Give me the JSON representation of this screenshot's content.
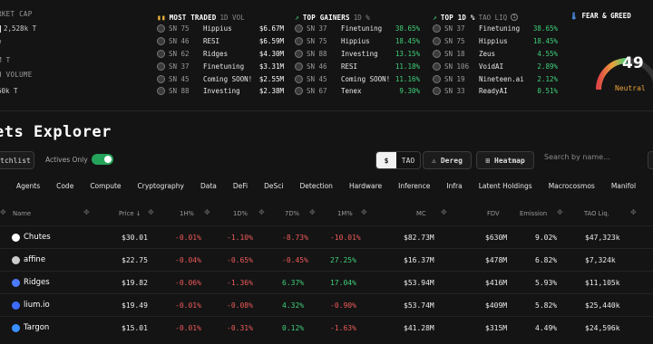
{
  "stats": {
    "market_cap_label": "RKET CAP",
    "market_cap_value": "2,528k T",
    "v_label": "V",
    "t_label": "M T",
    "volume_label": "H VOLUME",
    "volume_value": "60k T"
  },
  "most_traded": {
    "title": "MOST TRADED",
    "subtitle": "1D VOL",
    "rows": [
      {
        "sn": "SN 75",
        "name": "Hippius",
        "value": "$6.67M"
      },
      {
        "sn": "SN 46",
        "name": "RESI",
        "value": "$6.59M"
      },
      {
        "sn": "SN 62",
        "name": "Ridges",
        "value": "$4.30M"
      },
      {
        "sn": "SN 37",
        "name": "Finetuning",
        "value": "$3.31M"
      },
      {
        "sn": "SN 45",
        "name": "Coming SOON!",
        "value": "$2.55M"
      },
      {
        "sn": "SN 88",
        "name": "Investing",
        "value": "$2.38M"
      }
    ]
  },
  "top_gainers": {
    "title": "TOP GAINERS",
    "subtitle": "1D %",
    "rows": [
      {
        "sn": "SN 37",
        "name": "Finetuning",
        "value": "38.65%"
      },
      {
        "sn": "SN 75",
        "name": "Hippius",
        "value": "18.45%"
      },
      {
        "sn": "SN 88",
        "name": "Investing",
        "value": "13.15%"
      },
      {
        "sn": "SN 46",
        "name": "RESI",
        "value": "11.18%"
      },
      {
        "sn": "SN 45",
        "name": "Coming SOON!",
        "value": "11.16%"
      },
      {
        "sn": "SN 67",
        "name": "Tenex",
        "value": "9.30%"
      }
    ]
  },
  "top_1d": {
    "title": "TOP 1D %",
    "subtitle": "TAO LIQ",
    "rows": [
      {
        "sn": "SN 37",
        "name": "Finetuning",
        "value": "38.65%"
      },
      {
        "sn": "SN 75",
        "name": "Hippius",
        "value": "18.45%"
      },
      {
        "sn": "SN 18",
        "name": "Zeus",
        "value": "4.55%"
      },
      {
        "sn": "SN 106",
        "name": "VoidAI",
        "value": "2.89%"
      },
      {
        "sn": "SN 19",
        "name": "Nineteen.ai",
        "value": "2.12%"
      },
      {
        "sn": "SN 33",
        "name": "ReadyAI",
        "value": "0.51%"
      }
    ]
  },
  "fear_greed": {
    "title": "FEAR & GREED",
    "value": "49",
    "level": 0.49,
    "label": "Neutral"
  },
  "explorer": {
    "title": "ets Explorer",
    "watchlist": "tchlist",
    "actives_only": "Actives Only",
    "currency_usd": "$",
    "currency_tao": "TAO",
    "dereg": "Dereg",
    "heatmap": "Heatmap",
    "search_placeholder": "Search by name...",
    "categories": [
      "Agents",
      "Code",
      "Compute",
      "Cryptography",
      "Data",
      "DeFi",
      "DeSci",
      "Detection",
      "Hardware",
      "Inference",
      "Infra",
      "Latent Holdings",
      "Macrocosmos",
      "Manifol"
    ]
  },
  "table": {
    "headers": {
      "name": "Name",
      "price": "Price",
      "h1": "1H%",
      "d1": "1D%",
      "d7": "7D%",
      "m1": "1M%",
      "mc": "MC",
      "fdv": "FDV",
      "emission": "Emission",
      "tao_liq": "TAO Liq."
    },
    "rows": [
      {
        "name": "Chutes",
        "price": "$30.01",
        "h1": "-0.01%",
        "d1": "-1.10%",
        "d7": "-8.73%",
        "m1": "-10.01%",
        "mc": "$82.73M",
        "fdv": "$630M",
        "emission": "9.02%",
        "tao_liq": "$47,323k"
      },
      {
        "name": "affine",
        "price": "$22.75",
        "h1": "-0.04%",
        "d1": "-0.65%",
        "d7": "-0.45%",
        "m1": "27.25%",
        "mc": "$16.37M",
        "fdv": "$478M",
        "emission": "6.82%",
        "tao_liq": "$7,324k"
      },
      {
        "name": "Ridges",
        "price": "$19.82",
        "h1": "-0.06%",
        "d1": "-1.36%",
        "d7": "6.37%",
        "m1": "17.04%",
        "mc": "$53.94M",
        "fdv": "$416M",
        "emission": "5.93%",
        "tao_liq": "$11,105k"
      },
      {
        "name": "lium.io",
        "price": "$19.49",
        "h1": "-0.01%",
        "d1": "-0.08%",
        "d7": "4.32%",
        "m1": "-0.90%",
        "mc": "$53.74M",
        "fdv": "$409M",
        "emission": "5.82%",
        "tao_liq": "$25,440k"
      },
      {
        "name": "Targon",
        "price": "$15.01",
        "h1": "-0.01%",
        "d1": "-0.31%",
        "d7": "0.12%",
        "m1": "-1.63%",
        "mc": "$41.28M",
        "fdv": "$315M",
        "emission": "4.49%",
        "tao_liq": "$24,596k"
      }
    ]
  },
  "colors": {
    "background": "#141414",
    "positive": "#3fd07a",
    "negative": "#ef5a5a",
    "toggle_on": "#24a35a",
    "neutral": "#e8a23a"
  }
}
